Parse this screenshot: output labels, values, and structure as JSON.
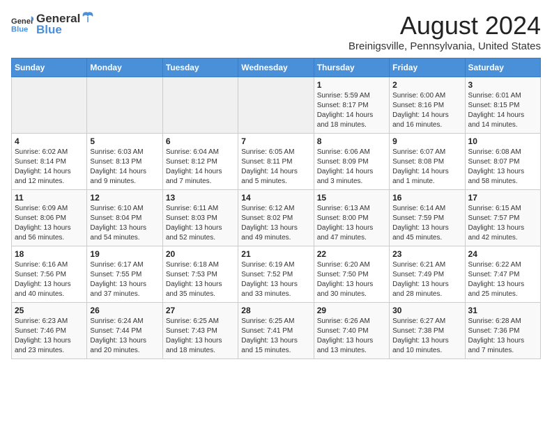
{
  "header": {
    "logo_general": "General",
    "logo_blue": "Blue",
    "title": "August 2024",
    "subtitle": "Breinigsville, Pennsylvania, United States"
  },
  "calendar": {
    "days_of_week": [
      "Sunday",
      "Monday",
      "Tuesday",
      "Wednesday",
      "Thursday",
      "Friday",
      "Saturday"
    ],
    "weeks": [
      [
        {
          "day": "",
          "empty": true
        },
        {
          "day": "",
          "empty": true
        },
        {
          "day": "",
          "empty": true
        },
        {
          "day": "",
          "empty": true
        },
        {
          "day": "1",
          "sunrise": "5:59 AM",
          "sunset": "8:17 PM",
          "daylight": "14 hours and 18 minutes."
        },
        {
          "day": "2",
          "sunrise": "6:00 AM",
          "sunset": "8:16 PM",
          "daylight": "14 hours and 16 minutes."
        },
        {
          "day": "3",
          "sunrise": "6:01 AM",
          "sunset": "8:15 PM",
          "daylight": "14 hours and 14 minutes."
        }
      ],
      [
        {
          "day": "4",
          "sunrise": "6:02 AM",
          "sunset": "8:14 PM",
          "daylight": "14 hours and 12 minutes."
        },
        {
          "day": "5",
          "sunrise": "6:03 AM",
          "sunset": "8:13 PM",
          "daylight": "14 hours and 9 minutes."
        },
        {
          "day": "6",
          "sunrise": "6:04 AM",
          "sunset": "8:12 PM",
          "daylight": "14 hours and 7 minutes."
        },
        {
          "day": "7",
          "sunrise": "6:05 AM",
          "sunset": "8:11 PM",
          "daylight": "14 hours and 5 minutes."
        },
        {
          "day": "8",
          "sunrise": "6:06 AM",
          "sunset": "8:09 PM",
          "daylight": "14 hours and 3 minutes."
        },
        {
          "day": "9",
          "sunrise": "6:07 AM",
          "sunset": "8:08 PM",
          "daylight": "14 hours and 1 minute."
        },
        {
          "day": "10",
          "sunrise": "6:08 AM",
          "sunset": "8:07 PM",
          "daylight": "13 hours and 58 minutes."
        }
      ],
      [
        {
          "day": "11",
          "sunrise": "6:09 AM",
          "sunset": "8:06 PM",
          "daylight": "13 hours and 56 minutes."
        },
        {
          "day": "12",
          "sunrise": "6:10 AM",
          "sunset": "8:04 PM",
          "daylight": "13 hours and 54 minutes."
        },
        {
          "day": "13",
          "sunrise": "6:11 AM",
          "sunset": "8:03 PM",
          "daylight": "13 hours and 52 minutes."
        },
        {
          "day": "14",
          "sunrise": "6:12 AM",
          "sunset": "8:02 PM",
          "daylight": "13 hours and 49 minutes."
        },
        {
          "day": "15",
          "sunrise": "6:13 AM",
          "sunset": "8:00 PM",
          "daylight": "13 hours and 47 minutes."
        },
        {
          "day": "16",
          "sunrise": "6:14 AM",
          "sunset": "7:59 PM",
          "daylight": "13 hours and 45 minutes."
        },
        {
          "day": "17",
          "sunrise": "6:15 AM",
          "sunset": "7:57 PM",
          "daylight": "13 hours and 42 minutes."
        }
      ],
      [
        {
          "day": "18",
          "sunrise": "6:16 AM",
          "sunset": "7:56 PM",
          "daylight": "13 hours and 40 minutes."
        },
        {
          "day": "19",
          "sunrise": "6:17 AM",
          "sunset": "7:55 PM",
          "daylight": "13 hours and 37 minutes."
        },
        {
          "day": "20",
          "sunrise": "6:18 AM",
          "sunset": "7:53 PM",
          "daylight": "13 hours and 35 minutes."
        },
        {
          "day": "21",
          "sunrise": "6:19 AM",
          "sunset": "7:52 PM",
          "daylight": "13 hours and 33 minutes."
        },
        {
          "day": "22",
          "sunrise": "6:20 AM",
          "sunset": "7:50 PM",
          "daylight": "13 hours and 30 minutes."
        },
        {
          "day": "23",
          "sunrise": "6:21 AM",
          "sunset": "7:49 PM",
          "daylight": "13 hours and 28 minutes."
        },
        {
          "day": "24",
          "sunrise": "6:22 AM",
          "sunset": "7:47 PM",
          "daylight": "13 hours and 25 minutes."
        }
      ],
      [
        {
          "day": "25",
          "sunrise": "6:23 AM",
          "sunset": "7:46 PM",
          "daylight": "13 hours and 23 minutes."
        },
        {
          "day": "26",
          "sunrise": "6:24 AM",
          "sunset": "7:44 PM",
          "daylight": "13 hours and 20 minutes."
        },
        {
          "day": "27",
          "sunrise": "6:25 AM",
          "sunset": "7:43 PM",
          "daylight": "13 hours and 18 minutes."
        },
        {
          "day": "28",
          "sunrise": "6:25 AM",
          "sunset": "7:41 PM",
          "daylight": "13 hours and 15 minutes."
        },
        {
          "day": "29",
          "sunrise": "6:26 AM",
          "sunset": "7:40 PM",
          "daylight": "13 hours and 13 minutes."
        },
        {
          "day": "30",
          "sunrise": "6:27 AM",
          "sunset": "7:38 PM",
          "daylight": "13 hours and 10 minutes."
        },
        {
          "day": "31",
          "sunrise": "6:28 AM",
          "sunset": "7:36 PM",
          "daylight": "13 hours and 7 minutes."
        }
      ]
    ]
  }
}
